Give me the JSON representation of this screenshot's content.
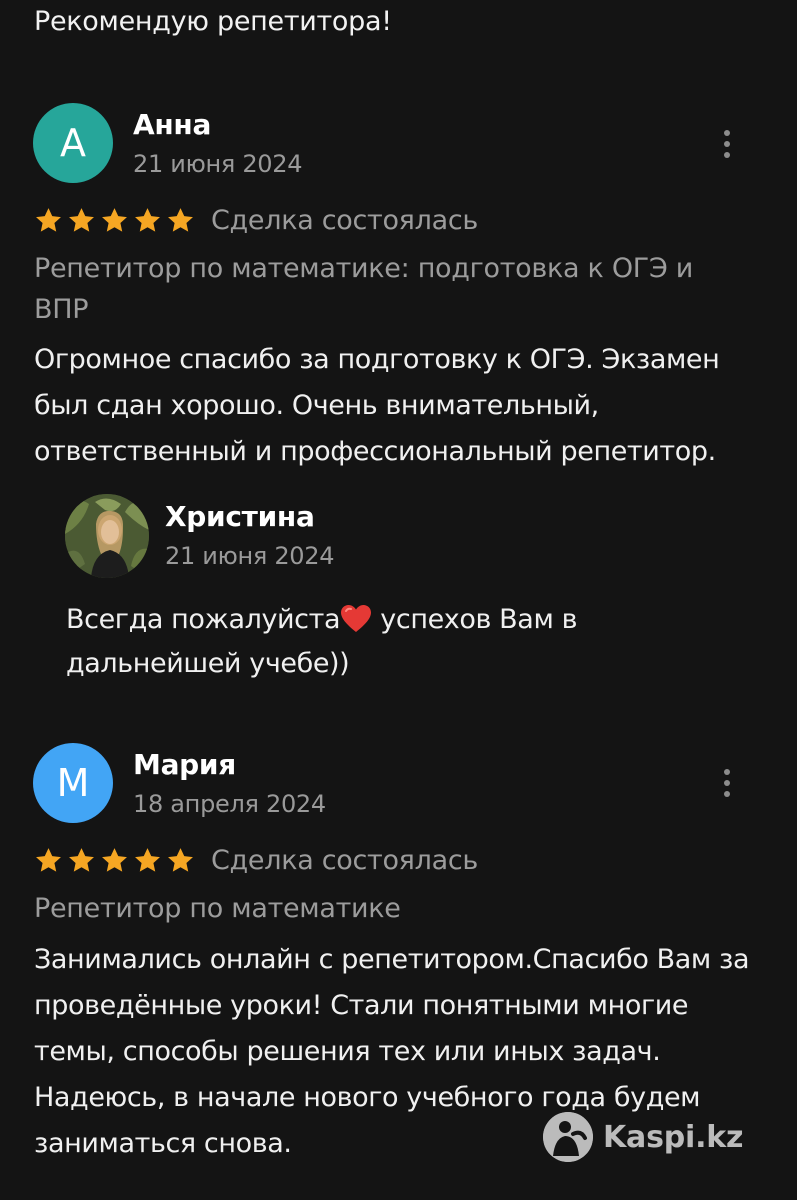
{
  "top_text": "Рекомендую репетитора!",
  "reviews": [
    {
      "avatar_letter": "А",
      "avatar_color": "#26a69a",
      "author": "Анна",
      "date": "21 июня 2024",
      "rating": 5,
      "deal_status": "Сделка состоялась",
      "product": "Репетитор по математике: подготовка к ОГЭ и ВПР",
      "text": "Огромное спасибо за подготовку к ОГЭ. Экзамен был сдан хорошо. Очень внимательный, ответственный и профессиональный репетитор.",
      "reply": {
        "author": "Христина",
        "date": "21 июня 2024",
        "text_before_emoji": "Всегда пожалуйста",
        "emoji": "red-heart",
        "text_after_emoji": " успехов Вам в дальнейшей учебе))"
      }
    },
    {
      "avatar_letter": "М",
      "avatar_color": "#42a5f5",
      "author": "Мария",
      "date": "18 апреля 2024",
      "rating": 5,
      "deal_status": "Сделка состоялась",
      "product": "Репетитор по математике",
      "text": "Занимались онлайн с репетитором.Спасибо Вам за проведённые уроки!  Стали понятными многие темы, способы решения тех или иных задач. Надеюсь, в начале нового учебного года будем заниматься снова."
    }
  ],
  "colors": {
    "background": "#141414",
    "star": "#f5a623",
    "secondary_text": "#9c9c9c"
  },
  "watermark": {
    "text": "Kaspi.kz",
    "icon": "kaspi-logo-icon"
  }
}
